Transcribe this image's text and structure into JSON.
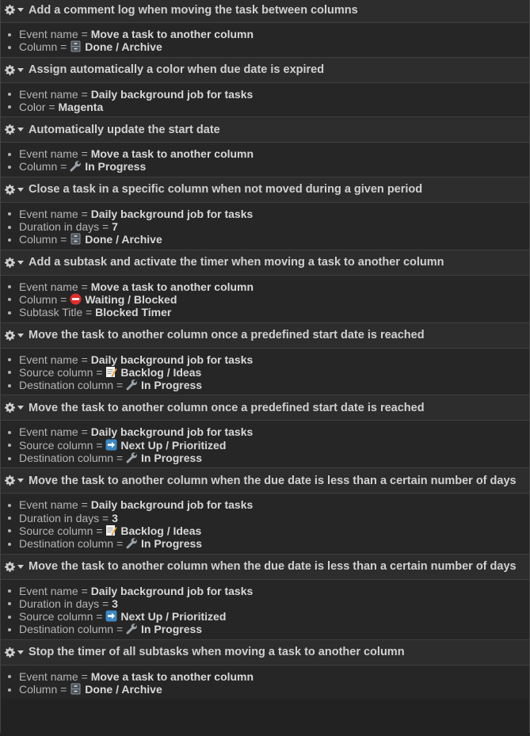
{
  "icons": {
    "gear": "gear-icon",
    "caret": "caret-down-icon",
    "done": "file-cabinet-icon",
    "progress": "wrench-icon",
    "blocked": "no-entry-icon",
    "backlog": "memo-icon",
    "next": "right-arrow-icon"
  },
  "actions": [
    {
      "title": "Add a comment log when moving the task between columns",
      "params": [
        {
          "label": "Event name",
          "value": "Move a task to another column"
        },
        {
          "label": "Column",
          "icon": "done",
          "value": "Done / Archive"
        }
      ]
    },
    {
      "title": "Assign automatically a color when due date is expired",
      "params": [
        {
          "label": "Event name",
          "value": "Daily background job for tasks"
        },
        {
          "label": "Color",
          "value": "Magenta"
        }
      ]
    },
    {
      "title": "Automatically update the start date",
      "params": [
        {
          "label": "Event name",
          "value": "Move a task to another column"
        },
        {
          "label": "Column",
          "icon": "progress",
          "value": "In Progress"
        }
      ]
    },
    {
      "title": "Close a task in a specific column when not moved during a given period",
      "params": [
        {
          "label": "Event name",
          "value": "Daily background job for tasks"
        },
        {
          "label": "Duration in days",
          "value": "7"
        },
        {
          "label": "Column",
          "icon": "done",
          "value": "Done / Archive"
        }
      ]
    },
    {
      "title": "Add a subtask and activate the timer when moving a task to another column",
      "params": [
        {
          "label": "Event name",
          "value": "Move a task to another column"
        },
        {
          "label": "Column",
          "icon": "blocked",
          "value": "Waiting / Blocked"
        },
        {
          "label": "Subtask Title",
          "value": "Blocked Timer"
        }
      ]
    },
    {
      "title": "Move the task to another column once a predefined start date is reached",
      "params": [
        {
          "label": "Event name",
          "value": "Daily background job for tasks"
        },
        {
          "label": "Source column",
          "icon": "backlog",
          "value": "Backlog / Ideas"
        },
        {
          "label": "Destination column",
          "icon": "progress",
          "value": "In Progress"
        }
      ]
    },
    {
      "title": "Move the task to another column once a predefined start date is reached",
      "params": [
        {
          "label": "Event name",
          "value": "Daily background job for tasks"
        },
        {
          "label": "Source column",
          "icon": "next",
          "value": "Next Up / Prioritized"
        },
        {
          "label": "Destination column",
          "icon": "progress",
          "value": "In Progress"
        }
      ]
    },
    {
      "title": "Move the task to another column when the due date is less than a certain number of days",
      "params": [
        {
          "label": "Event name",
          "value": "Daily background job for tasks"
        },
        {
          "label": "Duration in days",
          "value": "3"
        },
        {
          "label": "Source column",
          "icon": "backlog",
          "value": "Backlog / Ideas"
        },
        {
          "label": "Destination column",
          "icon": "progress",
          "value": "In Progress"
        }
      ]
    },
    {
      "title": "Move the task to another column when the due date is less than a certain number of days",
      "params": [
        {
          "label": "Event name",
          "value": "Daily background job for tasks"
        },
        {
          "label": "Duration in days",
          "value": "3"
        },
        {
          "label": "Source column",
          "icon": "next",
          "value": "Next Up / Prioritized"
        },
        {
          "label": "Destination column",
          "icon": "progress",
          "value": "In Progress"
        }
      ]
    },
    {
      "title": "Stop the timer of all subtasks when moving a task to another column",
      "params": [
        {
          "label": "Event name",
          "value": "Move a task to another column"
        },
        {
          "label": "Column",
          "icon": "done",
          "value": "Done / Archive"
        }
      ]
    }
  ]
}
